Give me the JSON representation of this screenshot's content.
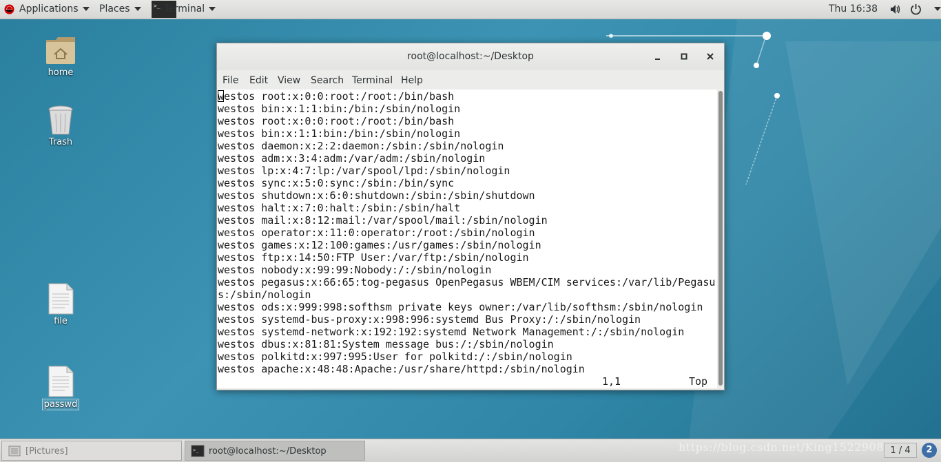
{
  "topbar": {
    "applications": "Applications",
    "places": "Places",
    "terminal": "Terminal",
    "clock": "Thu 16:38"
  },
  "desktop": {
    "icons": [
      {
        "label": "home"
      },
      {
        "label": "Trash"
      },
      {
        "label": "file"
      },
      {
        "label": "passwd"
      }
    ]
  },
  "window": {
    "title": "root@localhost:~/Desktop",
    "menu": [
      "File",
      "Edit",
      "View",
      "Search",
      "Terminal",
      "Help"
    ],
    "lines": [
      "westos root:x:0:0:root:/root:/bin/bash",
      "westos bin:x:1:1:bin:/bin:/sbin/nologin",
      "westos root:x:0:0:root:/root:/bin/bash",
      "westos bin:x:1:1:bin:/bin:/sbin/nologin",
      "westos daemon:x:2:2:daemon:/sbin:/sbin/nologin",
      "westos adm:x:3:4:adm:/var/adm:/sbin/nologin",
      "westos lp:x:4:7:lp:/var/spool/lpd:/sbin/nologin",
      "westos sync:x:5:0:sync:/sbin:/bin/sync",
      "westos shutdown:x:6:0:shutdown:/sbin:/sbin/shutdown",
      "westos halt:x:7:0:halt:/sbin:/sbin/halt",
      "westos mail:x:8:12:mail:/var/spool/mail:/sbin/nologin",
      "westos operator:x:11:0:operator:/root:/sbin/nologin",
      "westos games:x:12:100:games:/usr/games:/sbin/nologin",
      "westos ftp:x:14:50:FTP User:/var/ftp:/sbin/nologin",
      "westos nobody:x:99:99:Nobody:/:/sbin/nologin",
      "westos pegasus:x:66:65:tog-pegasus OpenPegasus WBEM/CIM services:/var/lib/Pegasu",
      "s:/sbin/nologin",
      "westos ods:x:999:998:softhsm private keys owner:/var/lib/softhsm:/sbin/nologin",
      "westos systemd-bus-proxy:x:998:996:systemd Bus Proxy:/:/sbin/nologin",
      "westos systemd-network:x:192:192:systemd Network Management:/:/sbin/nologin",
      "westos dbus:x:81:81:System message bus:/:/sbin/nologin",
      "westos polkitd:x:997:995:User for polkitd:/:/sbin/nologin",
      "westos apache:x:48:48:Apache:/usr/share/httpd:/sbin/nologin"
    ],
    "status_pos": "1,1",
    "status_where": "Top"
  },
  "taskbar": {
    "task1": "[Pictures]",
    "task2": "root@localhost:~/Desktop",
    "watermark": "https://blog.csdn.net/King15229085063",
    "workspace": "1 / 4",
    "notifications": "2"
  }
}
